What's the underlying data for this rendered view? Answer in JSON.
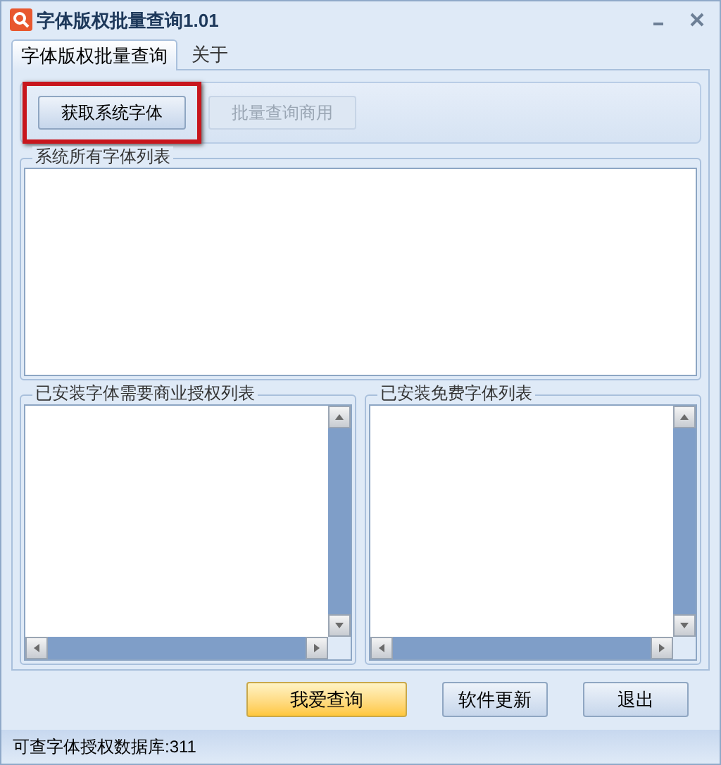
{
  "window": {
    "title": "字体版权批量查询1.01"
  },
  "tabs": [
    {
      "label": "字体版权批量查询",
      "selected": true
    },
    {
      "label": "关于",
      "selected": false
    }
  ],
  "toolbar_buttons": [
    {
      "label": "获取系统字体",
      "disabled": false,
      "highlighted": true
    },
    {
      "label": "批量查询商用",
      "disabled": true,
      "highlighted": false
    }
  ],
  "all_fonts_group": {
    "title": "系统所有字体列表"
  },
  "commercial_group": {
    "title": "已安装字体需要商业授权列表"
  },
  "free_group": {
    "title": "已安装免费字体列表"
  },
  "bottom_buttons": [
    {
      "label": "我爱查询",
      "kind": "primary"
    },
    {
      "label": "软件更新",
      "kind": "normal"
    },
    {
      "label": "退出",
      "kind": "normal"
    }
  ],
  "status_bar": {
    "text": "可查字体授权数据库:311"
  }
}
